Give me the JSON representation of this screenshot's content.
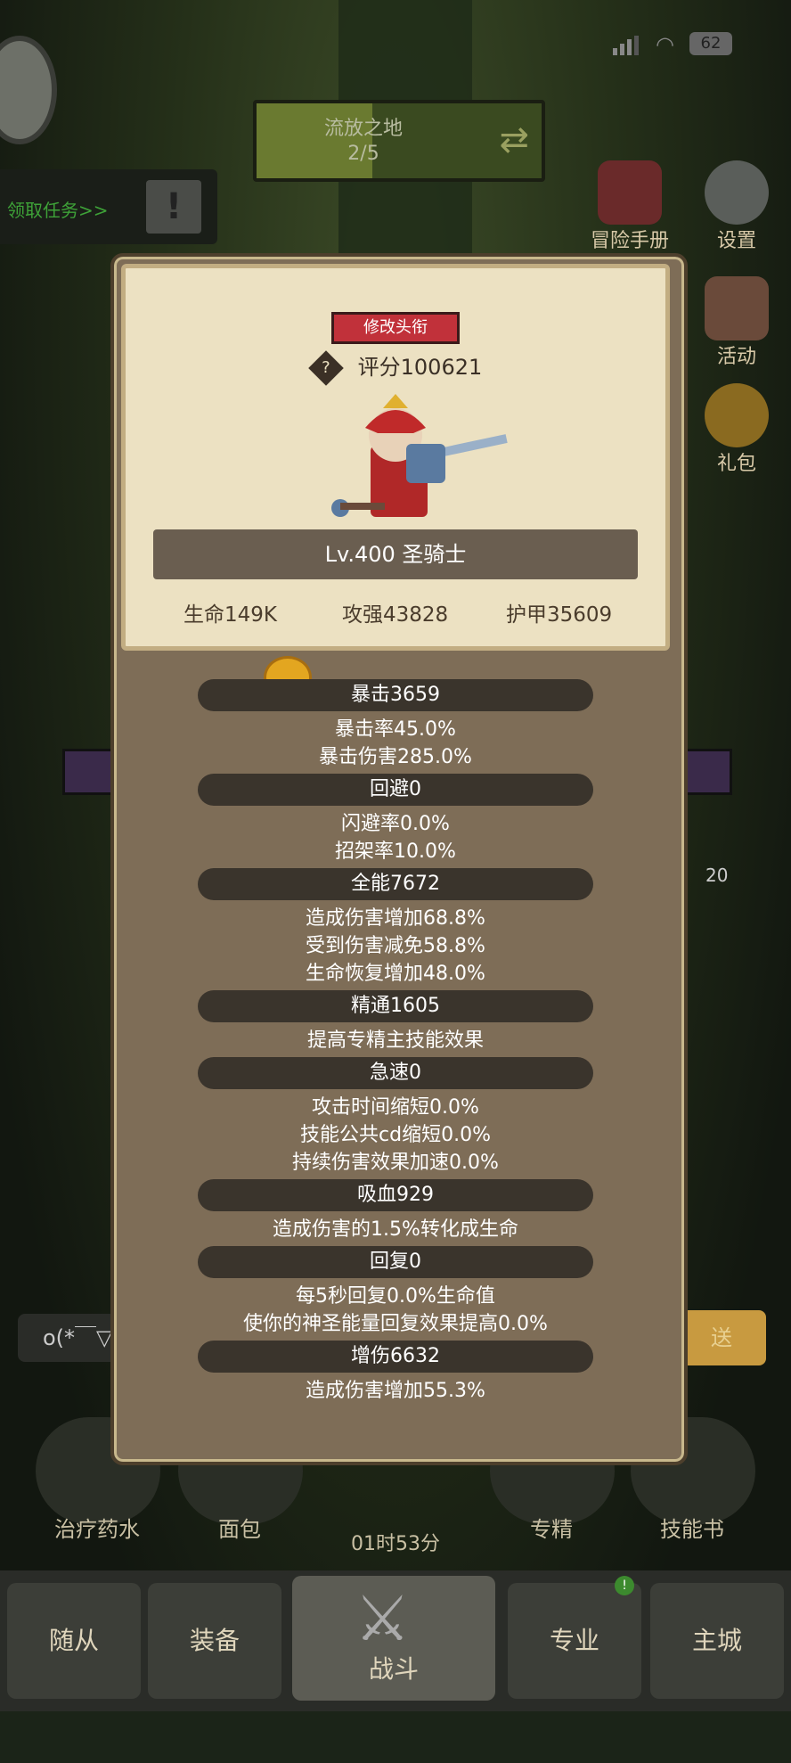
{
  "status": {
    "battery": "62"
  },
  "zone": {
    "name": "流放之地",
    "progress": "2/5"
  },
  "quest": {
    "label": "领取任务>>",
    "alert": "!"
  },
  "side": {
    "manual": "冒险手册",
    "settings": "设置",
    "activity": "活动",
    "gift": "礼包"
  },
  "modal": {
    "change_title": "修改头衔",
    "score_icon": "?",
    "score": "评分100621",
    "level_class": "Lv.400 圣骑士",
    "hp": "生命149K",
    "attack": "攻强43828",
    "armor": "护甲35609"
  },
  "stats": [
    {
      "header": "暴击3659",
      "lines": [
        "暴击率45.0%",
        "暴击伤害285.0%"
      ]
    },
    {
      "header": "回避0",
      "lines": [
        "闪避率0.0%",
        "招架率10.0%"
      ]
    },
    {
      "header": "全能7672",
      "lines": [
        "造成伤害增加68.8%",
        "受到伤害减免58.8%",
        "生命恢复增加48.0%"
      ]
    },
    {
      "header": "精通1605",
      "lines": [
        "提高专精主技能效果"
      ]
    },
    {
      "header": "急速0",
      "lines": [
        "攻击时间缩短0.0%",
        "技能公共cd缩短0.0%",
        "持续伤害效果加速0.0%"
      ]
    },
    {
      "header": "吸血929",
      "lines": [
        "造成伤害的1.5%转化成生命"
      ]
    },
    {
      "header": "回复0",
      "lines": [
        "每5秒回复0.0%生命值",
        "使你的神圣能量回复效果提高0.0%"
      ]
    },
    {
      "header": "增伤6632",
      "lines": [
        "造成伤害增加55.3%"
      ]
    }
  ],
  "background": {
    "badge": "20",
    "chat": "o(*￣▽",
    "send": "送"
  },
  "items": {
    "potion": "治疗药水",
    "bread": "面包",
    "spec": "专精",
    "skillbook": "技能书",
    "timer": "01时53分"
  },
  "tabs": {
    "follower": "随从",
    "equip": "装备",
    "battle": "战斗",
    "profession": "专业",
    "city": "主城",
    "notify": "!"
  }
}
